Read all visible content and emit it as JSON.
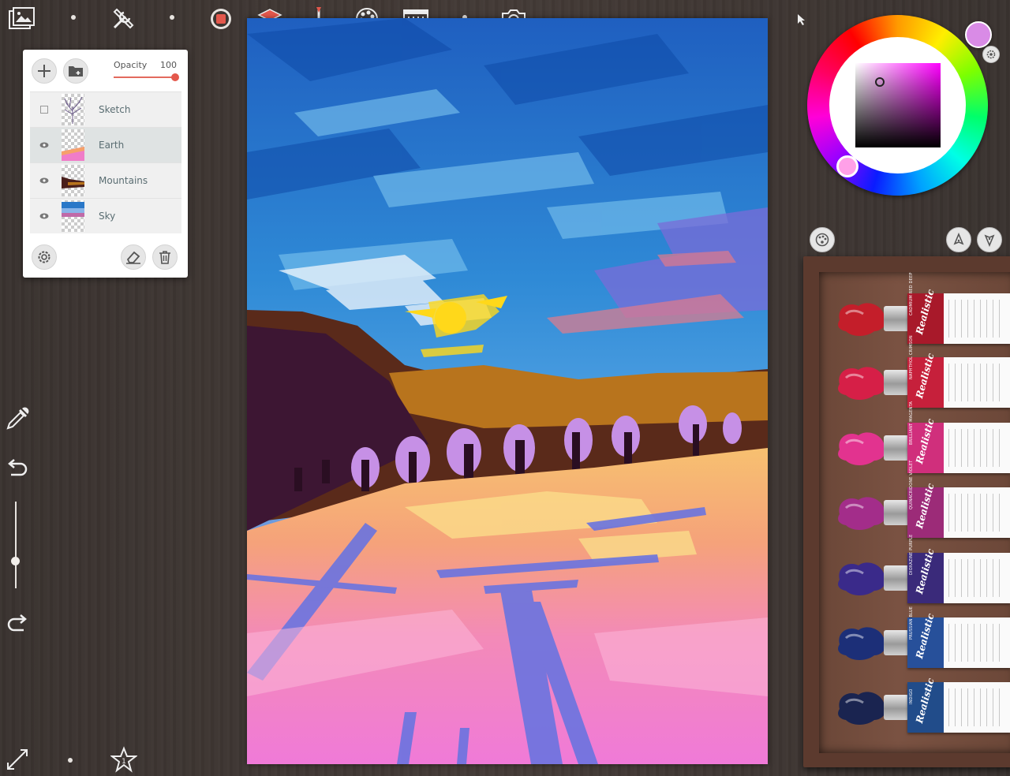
{
  "layers_panel": {
    "opacity_label": "Opacity",
    "opacity_value": "100",
    "layers": [
      {
        "name": "Sketch",
        "visible": false
      },
      {
        "name": "Earth",
        "visible": true,
        "selected": true
      },
      {
        "name": "Mountains",
        "visible": true
      },
      {
        "name": "Sky",
        "visible": true
      }
    ]
  },
  "toolbar": {
    "icons": [
      "gallery-icon",
      "tools-icon",
      "record-icon",
      "layers-icon",
      "brush-icon",
      "palette-icon",
      "reference-icon",
      "camera-icon"
    ]
  },
  "colors": {
    "current_color": "#d98be6",
    "selected_layer_bg": "#dfe3e3",
    "accent": "#e4584c"
  },
  "paint_tubes": [
    {
      "label": "CADMIUM RED DEEP",
      "color": "#c41e2a",
      "band": "#a8192a"
    },
    {
      "label": "NAPHTHOL CRIMSON",
      "color": "#d61f47",
      "band": "#c6203b"
    },
    {
      "label": "BRILLIANT MAGENTA",
      "color": "#e2338f",
      "band": "#d02f7c"
    },
    {
      "label": "QUINACRIDONE VIOLET",
      "color": "#a32d8a",
      "band": "#9c2b78"
    },
    {
      "label": "DIOXAZINE PURPLE",
      "color": "#3a2a8a",
      "band": "#3a2a7a"
    },
    {
      "label": "PRUSSIAN BLUE",
      "color": "#1c2f78",
      "band": "#27509a"
    },
    {
      "label": "INDIGO",
      "color": "#1a2450",
      "band": "#214c8a"
    }
  ],
  "tube_brand": "Realistic"
}
